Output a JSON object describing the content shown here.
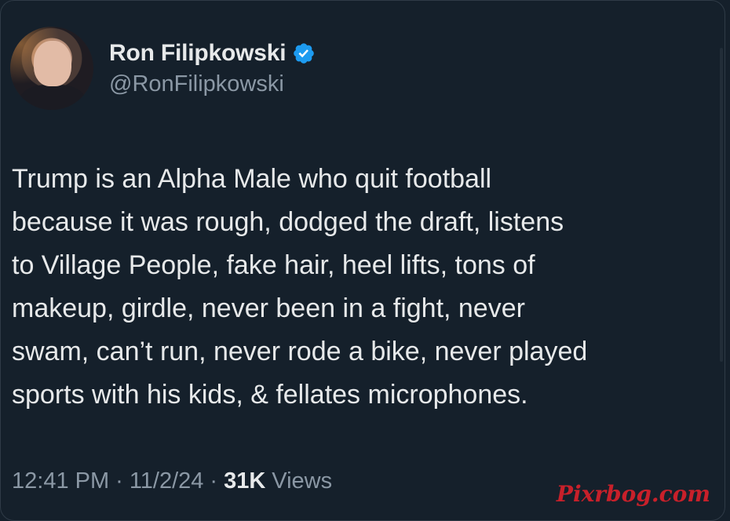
{
  "author": {
    "display_name": "Ron Filipkowski",
    "handle": "@RonFilipkowski",
    "verified": true,
    "verified_color": "#1d9bf0"
  },
  "tweet": {
    "text": "Trump is an Alpha Male who quit football\nbecause it was rough, dodged the draft, listens\nto Village People, fake hair, heel lifts, tons of\nmakeup, girdle, never been in a fight, never\nswam, can’t run, never rode a bike, never played\nsports with his kids, & fellates microphones."
  },
  "meta": {
    "time": "12:41 PM",
    "separator": "·",
    "date": "11/2/24",
    "views_count": "31K",
    "views_label": "Views"
  },
  "watermark": {
    "text": "Pixrbog.com",
    "color": "#c8202a"
  },
  "colors": {
    "background": "#15202b",
    "text": "#e7e9ea",
    "secondary_text": "#8b98a5"
  },
  "icons": {
    "verified": "verified-badge-icon",
    "avatar": "profile-photo"
  }
}
